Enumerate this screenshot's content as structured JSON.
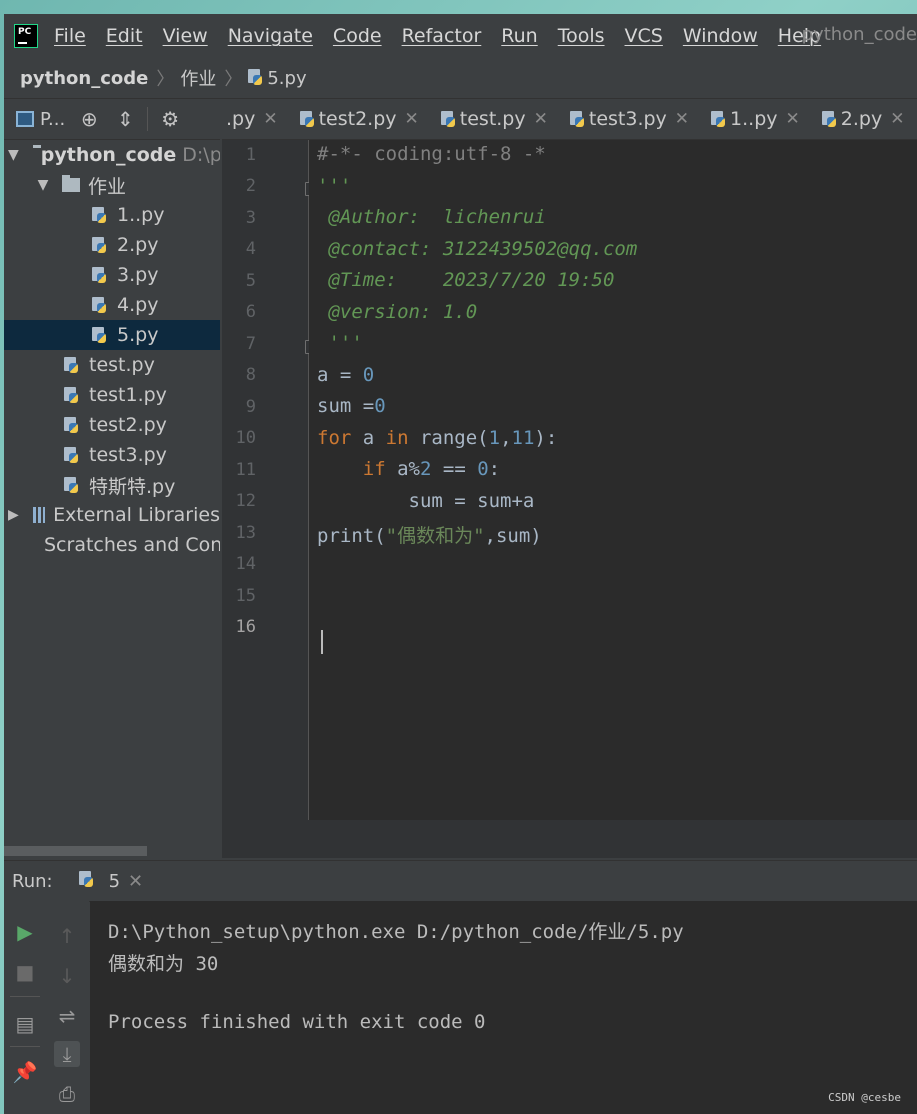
{
  "menubar": {
    "items": [
      "File",
      "Edit",
      "View",
      "Navigate",
      "Code",
      "Refactor",
      "Run",
      "Tools",
      "VCS",
      "Window",
      "Help"
    ],
    "title": "python_code"
  },
  "breadcrumb": {
    "project": "python_code",
    "folder": "作业",
    "file": "5.py"
  },
  "project_toolbar": {
    "label": "P..."
  },
  "tabs": [
    {
      "label": ".py"
    },
    {
      "label": "test2.py"
    },
    {
      "label": "test.py"
    },
    {
      "label": "test3.py"
    },
    {
      "label": "1..py"
    },
    {
      "label": "2.py"
    }
  ],
  "tree": {
    "root": "python_code",
    "root_path": "D:\\p",
    "folder": "作业",
    "folder_files": [
      "1..py",
      "2.py",
      "3.py",
      "4.py",
      "5.py"
    ],
    "selected": "5.py",
    "root_files": [
      "test.py",
      "test1.py",
      "test2.py",
      "test3.py",
      "特斯特.py"
    ],
    "external": "External Libraries",
    "scratches": "Scratches and Con"
  },
  "editor": {
    "line_numbers": [
      "1",
      "2",
      "3",
      "4",
      "5",
      "6",
      "7",
      "8",
      "9",
      "10",
      "11",
      "12",
      "13",
      "14",
      "15",
      "16"
    ],
    "current_line": "16"
  },
  "run": {
    "label": "Run:",
    "tab": "5",
    "output": [
      "D:\\Python_setup\\python.exe D:/python_code/作业/5.py",
      "偶数和为 30",
      "",
      "Process finished with exit code 0"
    ]
  },
  "watermark": "CSDN @cesbe",
  "colors": {
    "background": "#2b2b2b",
    "panel": "#3c3f41",
    "keyword": "#cc7832",
    "number": "#6897bb",
    "string": "#6a8759",
    "docstring": "#629755",
    "selection": "#0d293e",
    "run_green": "#59a869"
  }
}
